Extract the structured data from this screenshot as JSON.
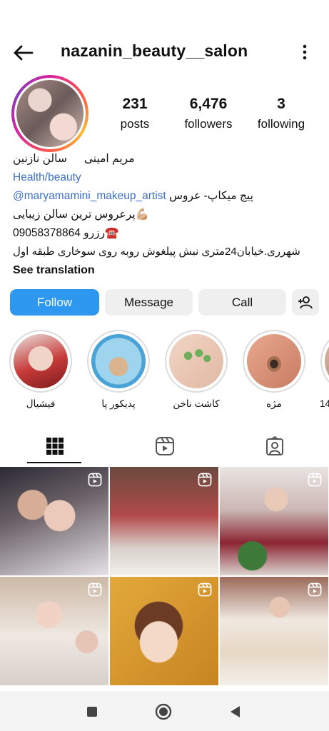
{
  "header": {
    "username": "nazanin_beauty__salon",
    "back_icon": "arrow-left-icon",
    "more_icon": "more-vertical-icon"
  },
  "stats": {
    "posts": {
      "value": "231",
      "label": "posts"
    },
    "followers": {
      "value": "6,476",
      "label": "followers"
    },
    "following": {
      "value": "3",
      "label": "following"
    }
  },
  "bio": {
    "name_1": "سالن نازنین",
    "name_2": "مریم امینی",
    "category": "Health/beauty",
    "line1_mention": "@maryamamini_makeup_artist",
    "line1_text": "پیج میکاپ- عروس",
    "line2": "💪🏼پرعروس ترین سالن زیبایی",
    "line3_prefix": "☎️رزرو",
    "line3_phone": "09058378864",
    "line4": "شهرری.خیابان24متری نبش پیلغوش روبه روی سوخاری طبقه  اول",
    "see_translation": "See translation"
  },
  "buttons": {
    "follow": "Follow",
    "message": "Message",
    "call": "Call",
    "add_user_icon": "add-user-icon"
  },
  "highlights": [
    {
      "label": "فیشیال",
      "color": "#c83a3a"
    },
    {
      "label": "پدیکور پا",
      "color": "#8ec9e8"
    },
    {
      "label": "کاشت ناخن",
      "color": "#7bb36b"
    },
    {
      "label": "مژه",
      "color": "#d9886e"
    },
    {
      "label": "14",
      "color": "#c9a48e"
    }
  ],
  "tabs": [
    {
      "name": "grid-icon"
    },
    {
      "name": "reels-icon"
    },
    {
      "name": "tagged-icon"
    }
  ],
  "colors": {
    "follow_blue": "#2e97f0",
    "link_blue": "#3b6fc6",
    "button_gray": "#efefef"
  }
}
